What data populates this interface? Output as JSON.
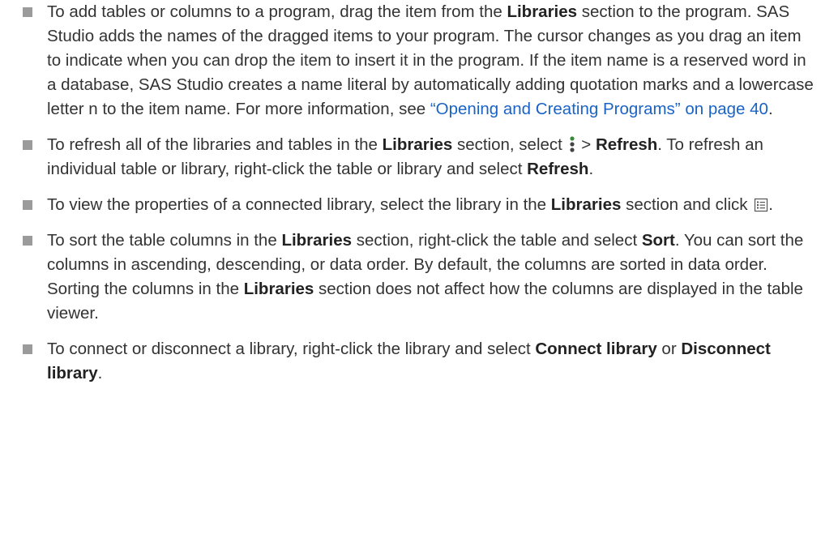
{
  "items": [
    {
      "t1": "To add tables or columns to a program, drag the item from the ",
      "b1": "Libraries",
      "t2": " section to the program. SAS Studio adds the names of the dragged items to your program. The cursor changes as you drag an item to indicate when you can drop the item to insert it in the program. If the item name is a reserved word in a database, SAS Studio creates a name literal by automatically adding quotation marks and a lowercase letter n to the item name. For more information, see ",
      "link": "“Opening and Creating Programs” on page 40",
      "t3": "."
    },
    {
      "t1": "To refresh all of the libraries and tables in the ",
      "b1": "Libraries",
      "t2": " section, select ",
      "icon": "more-options-icon",
      "t3": " > ",
      "b2": "Refresh",
      "t4": ". To refresh an individual table or library, right-click the table or library and select ",
      "b3": "Refresh",
      "t5": "."
    },
    {
      "t1": "To view the properties of a connected library, select the library in the ",
      "b1": "Libraries",
      "t2": " section and click ",
      "icon": "properties-icon",
      "t3": "."
    },
    {
      "t1": "To sort the table columns in the ",
      "b1": "Libraries",
      "t2": " section, right-click the table and select ",
      "b2": "Sort",
      "t3": ". You can sort the columns in ascending, descending, or data order. By default, the columns are sorted in data order. Sorting the columns in the ",
      "b3": "Libraries",
      "t4": " section does not affect how the columns are displayed in the table viewer."
    },
    {
      "t1": "To connect or disconnect a library, right-click the library and select ",
      "b1": "Connect library",
      "t2": " or ",
      "b2": "Disconnect library",
      "t3": "."
    }
  ],
  "colors": {
    "text": "#333333",
    "link": "#1a63c5",
    "bullet": "#9b9b9b"
  }
}
